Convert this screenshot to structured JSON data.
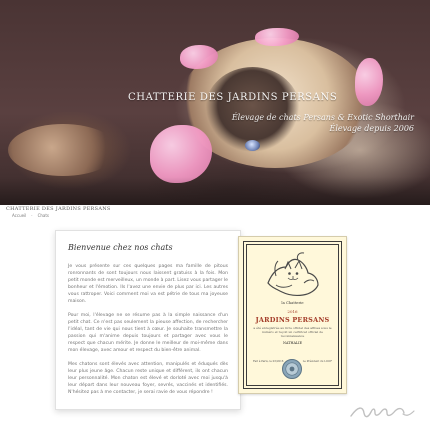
{
  "hero": {
    "title": "CHATTERIE DES JARDINS PERSANS",
    "tagline_line1": "Élevage de chats Persans & Exotic Shorthair",
    "tagline_line2": "Élevage depuis 2006"
  },
  "site_title_small": "CHATTERIE DES JARDINS PERSANS",
  "nav": {
    "items": [
      "Accueil",
      "·",
      "Chats"
    ]
  },
  "content": {
    "title": "Bienvenue chez nos chats",
    "paragraphs": [
      "Je vous présente sur ces quelques pages ma famille de pitous ronronnants de sont toujours nous laissent gratuiss à la fois. Mon petit monde est merveilleux, un monde à part. Lisez vous partager le bonheur et l'émotion. Ils l'avez une envie de plus par ici. Les autres vous rattroper. Voici comment moi va est pétrie de tous ma joyeuse maison.",
      "Pour moi, l'élevage ne se résume pas à la simple naissance d'un petit chat. Ce n'est pas seulement la pieuse affection, de rechercher l'idéal, tant de vie qui nous tient à cœur. Je souhaite transmettre la passion qui m'anime depuis toujours et partager avec vous le respect que chacun mérite. Je donne le meilleur de moi-même dans mon élevage, avec amour et respect du bien-être animal.",
      "Mes chatons sont élevés avec attention, manipulés et éduqués dès leur plus jeune âge. Chacun reste unique et différent, ils ont chacun leur personnalité. Mon chaton est élevé et dorloté avec moi jusqu'à leur départ dans leur nouveau foyer, sevrés, vaccinés et identifiés. N'hésitez pas à me contacter, je serai ravie de vous répondre !"
    ]
  },
  "certificate": {
    "line1": "la Chatterie",
    "year": "2016",
    "name": "JARDINS PERSANS",
    "body": "a été enregistrée au livre officiel des affixes sous le numéro et reçoit un certificat officiel de reconnaissance",
    "recipient": "NATHALIE",
    "left_footer": "Fait à Paris, le 03/2016",
    "right_footer": "Le Président du LOOF"
  },
  "colors": {
    "accent": "#a33a27",
    "text": "#747474",
    "heading": "#333333"
  }
}
